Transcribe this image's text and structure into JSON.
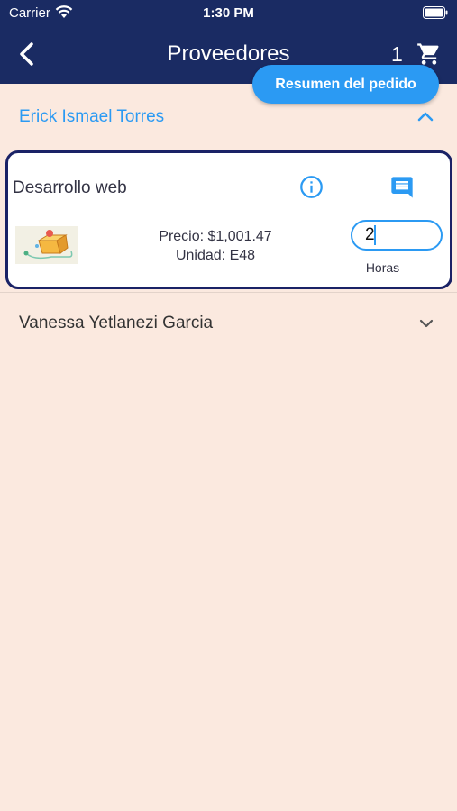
{
  "status_bar": {
    "carrier": "Carrier",
    "time": "1:30 PM"
  },
  "nav": {
    "title": "Proveedores",
    "cart_count": "1"
  },
  "summary_button": "Resumen del pedido",
  "providers": [
    {
      "name": "Erick Ismael Torres",
      "expanded": true,
      "products": [
        {
          "name": "Desarrollo web",
          "price": "Precio: $1,001.47",
          "unit": "Unidad: E48",
          "quantity": "2",
          "quantity_unit": "Horas"
        }
      ]
    },
    {
      "name": "Vanessa Yetlanezi Garcia",
      "expanded": false
    }
  ],
  "colors": {
    "header_bg": "#1a2b63",
    "accent": "#2b9af3",
    "background": "#fbe9df",
    "card_border": "#1a2266"
  },
  "icons": [
    "wifi-icon",
    "battery-icon",
    "back-arrow-icon",
    "cart-icon",
    "chevron-up-icon",
    "info-icon",
    "comment-icon",
    "chevron-down-icon"
  ]
}
